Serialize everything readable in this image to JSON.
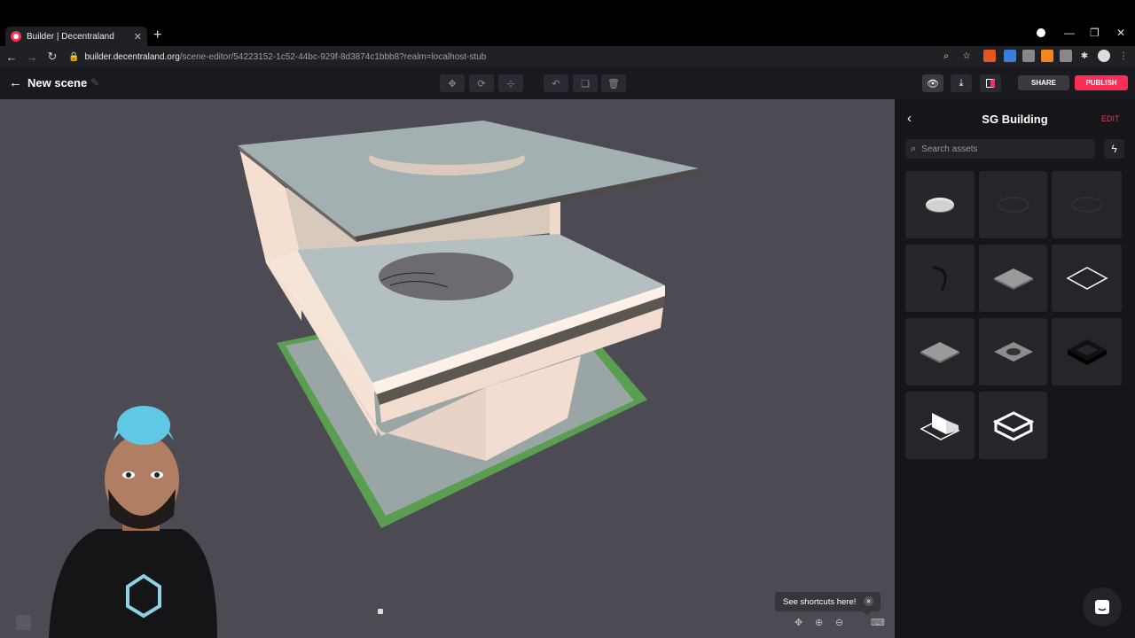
{
  "browser": {
    "tab_title": "Builder | Decentraland",
    "tab_close": "✕",
    "new_tab": "+",
    "url_host": "builder.decentraland.org",
    "url_path": "/scene-editor/54223152-1c52-44bc-929f-8d3874c1bbb8?realm=localhost-stub"
  },
  "header": {
    "back_icon": "←",
    "title": "New scene",
    "share_label": "SHARE",
    "publish_label": "PUBLISH"
  },
  "sidebar": {
    "back_icon": "‹",
    "title": "SG Building",
    "edit_label": "EDIT",
    "search_placeholder": "Search assets",
    "assets": [
      "ellipse-disc",
      "thin-circle",
      "thin-circle",
      "arc",
      "floor-tile",
      "outline-square",
      "floor-tile",
      "floor-with-hole",
      "thick-square-frame",
      "corner-block",
      "box-outline"
    ]
  },
  "viewport": {
    "shortcuts_tooltip": "See shortcuts here!",
    "tooltip_close": "✕"
  },
  "colors": {
    "accent": "#ff2d55",
    "viewport_bg": "#4c4a52",
    "sidebar_bg": "#16151a"
  }
}
